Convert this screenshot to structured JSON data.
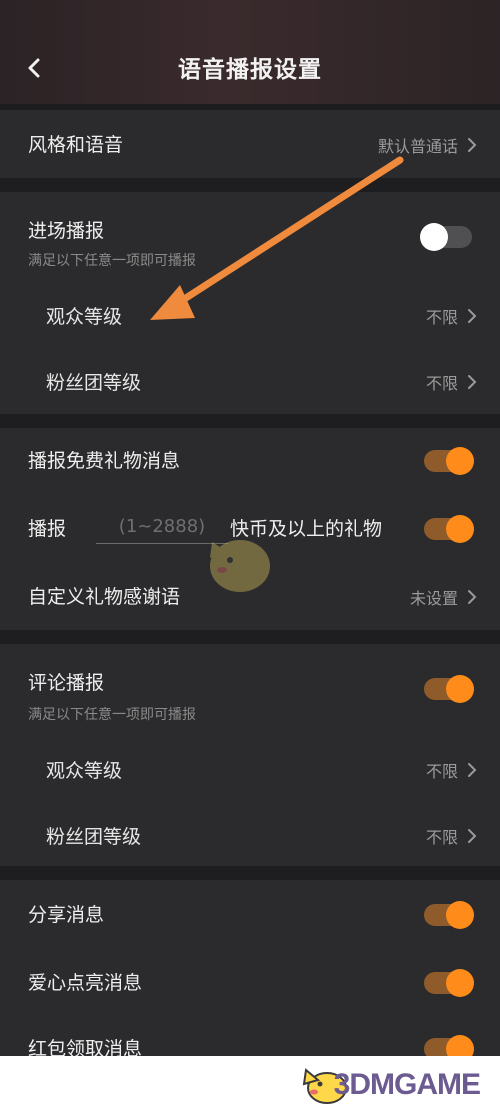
{
  "header": {
    "title": "语音播报设置"
  },
  "style_row": {
    "label": "风格和语音",
    "value": "默认普通话"
  },
  "entry": {
    "label": "进场播报",
    "hint": "满足以下任意一项即可播报",
    "toggle_on": false,
    "audience_level": {
      "label": "观众等级",
      "value": "不限"
    },
    "fan_level": {
      "label": "粉丝团等级",
      "value": "不限"
    }
  },
  "gifts": {
    "free_gift_label": "播报免费礼物消息",
    "free_gift_on": true,
    "threshold_prefix": "播报",
    "threshold_placeholder": "(1~2888)",
    "threshold_suffix": "快币及以上的礼物",
    "threshold_on": true,
    "thanks": {
      "label": "自定义礼物感谢语",
      "value": "未设置"
    }
  },
  "comment": {
    "label": "评论播报",
    "hint": "满足以下任意一项即可播报",
    "toggle_on": true,
    "audience_level": {
      "label": "观众等级",
      "value": "不限"
    },
    "fan_level": {
      "label": "粉丝团等级",
      "value": "不限"
    }
  },
  "misc": {
    "share_label": "分享消息",
    "share_on": true,
    "heart_label": "爱心点亮消息",
    "heart_on": true,
    "redpacket_label": "红包领取消息",
    "redpacket_on": true
  },
  "watermark": {
    "text": "3DMGAME"
  },
  "colors": {
    "accent": "#ff8c1a",
    "arrow": "#f08a3c",
    "background": "#2b2b2d"
  },
  "icons": [
    "back-arrow-icon",
    "chevron-right-icon",
    "mascot-logo-icon"
  ]
}
